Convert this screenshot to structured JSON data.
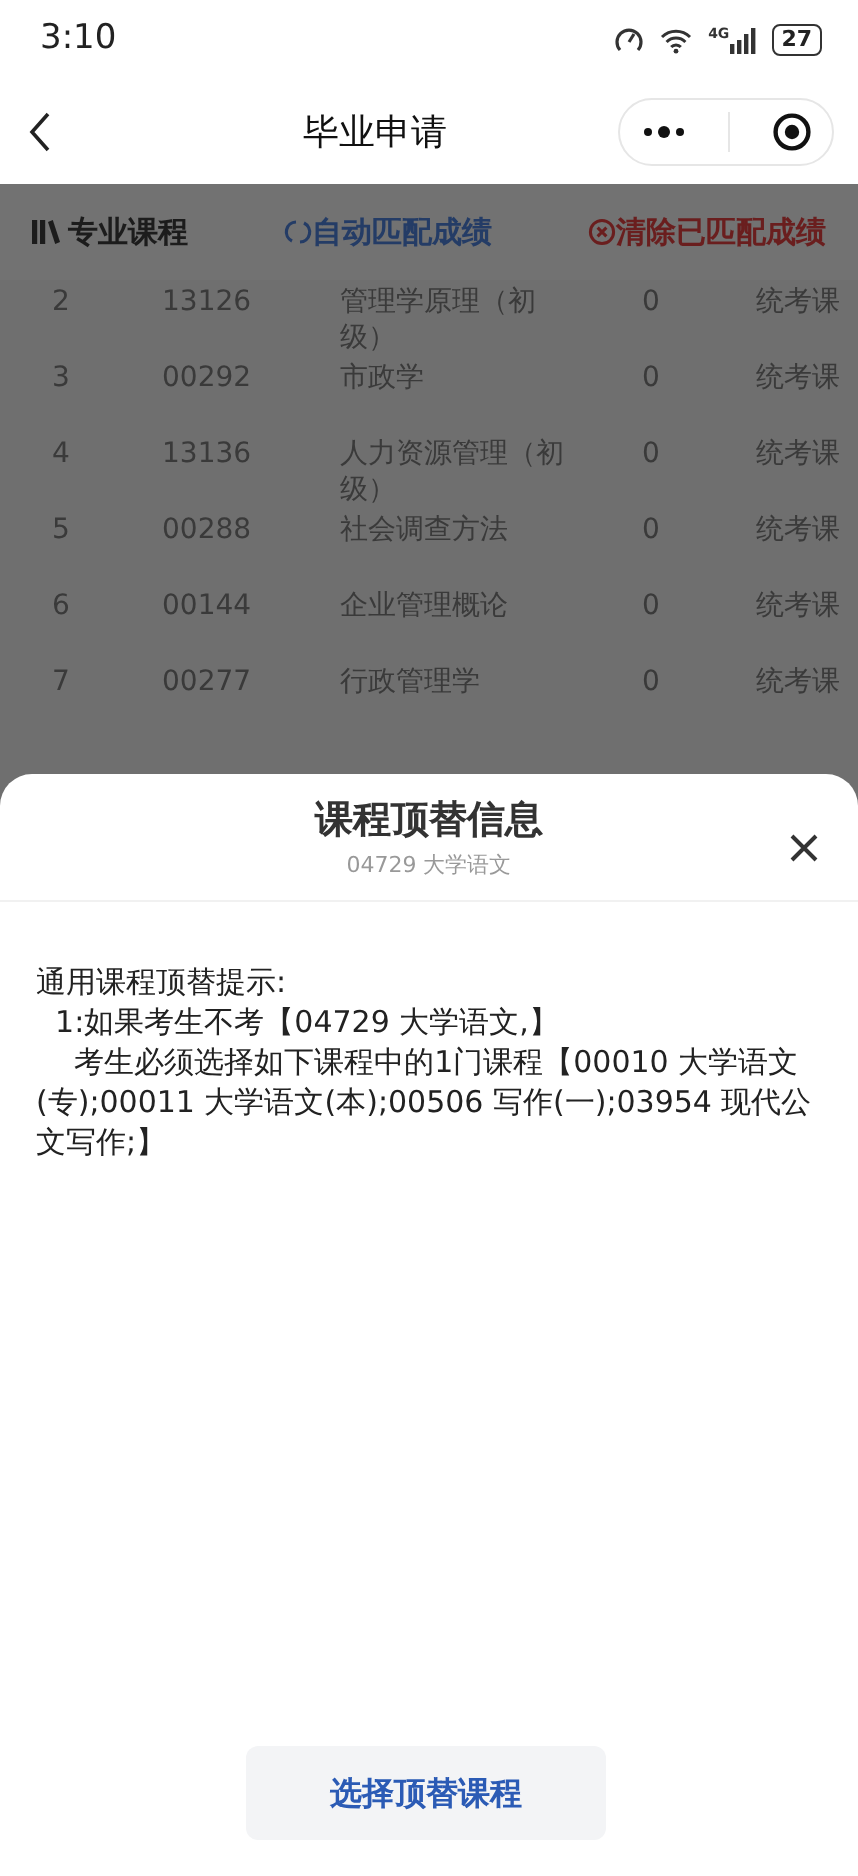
{
  "status_bar": {
    "time": "3:10",
    "battery": "27",
    "network": "4G"
  },
  "nav_bar": {
    "title": "毕业申请"
  },
  "section": {
    "title": "专业课程",
    "auto_match": "自动匹配成绩",
    "clear_match": "清除已匹配成绩"
  },
  "courses": [
    {
      "no": "2",
      "code": "13126",
      "name": "管理学原理（初级）",
      "score": "0",
      "type": "统考课"
    },
    {
      "no": "3",
      "code": "00292",
      "name": "市政学",
      "score": "0",
      "type": "统考课"
    },
    {
      "no": "4",
      "code": "13136",
      "name": "人力资源管理（初级）",
      "score": "0",
      "type": "统考课"
    },
    {
      "no": "5",
      "code": "00288",
      "name": "社会调查方法",
      "score": "0",
      "type": "统考课"
    },
    {
      "no": "6",
      "code": "00144",
      "name": "企业管理概论",
      "score": "0",
      "type": "统考课"
    },
    {
      "no": "7",
      "code": "00277",
      "name": "行政管理学",
      "score": "0",
      "type": "统考课"
    }
  ],
  "sheet": {
    "title": "课程顶替信息",
    "subtitle": "04729 大学语文",
    "lines": [
      "通用课程顶替提示:",
      "  1:如果考生不考【04729 大学语文,】",
      "    考生必须选择如下课程中的1门课程【00010 大学语文(专);00011 大学语文(本);00506 写作(一);03954 现代公文写作;】"
    ],
    "button": "选择顶替课程"
  }
}
